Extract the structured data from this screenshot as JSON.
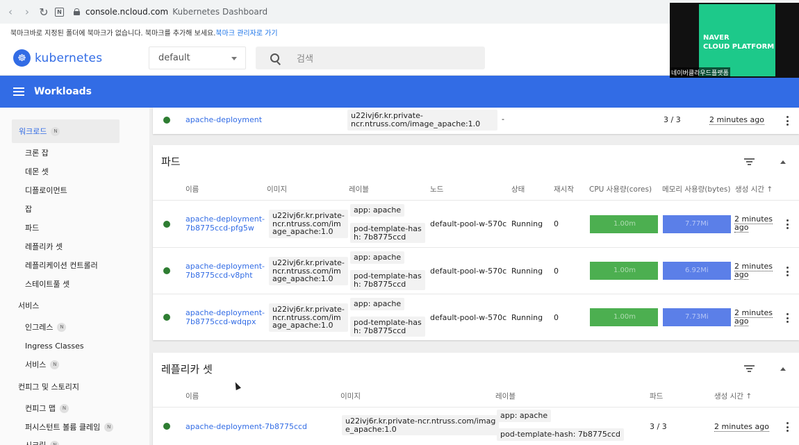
{
  "browser": {
    "url_host": "console.ncloud.com",
    "page_title": "Kubernetes Dashboard",
    "bookmark_msg": "북마크바로 지정된 폴더에 북마크가 없습니다. 북마크를 추가해 보세요.",
    "bookmark_link": "북마크 관리자로 가기"
  },
  "header": {
    "logo": "kubernetes",
    "namespace": "default",
    "search_placeholder": "검색"
  },
  "toolbar": {
    "title": "Workloads"
  },
  "sidebar": {
    "active": "워크로드",
    "active_badge": "N",
    "items_workload": [
      "크론 잡",
      "데몬 셋",
      "디플로이먼트",
      "잡",
      "파드",
      "레플리카 셋",
      "레플리케이션 컨트롤러",
      "스테이트풀 셋"
    ],
    "group_services": "서비스",
    "services": {
      "ingress": "인그레스",
      "ingress_classes": "Ingress Classes",
      "service": "서비스",
      "badge": "N"
    },
    "group_config": "컨피그 및 스토리지",
    "config": {
      "configmap": "컨피그 맵",
      "pvc": "퍼시스턴트 볼륨 클레임",
      "secret": "시크릿",
      "badge": "N"
    }
  },
  "deployment": {
    "name": "apache-deployment",
    "image": "u22ivj6r.kr.private-ncr.ntruss.com/image_apache:1.0",
    "labels": "-",
    "pods": "3 / 3",
    "created": "2 minutes ago"
  },
  "pods": {
    "title": "파드",
    "headers": {
      "name": "이름",
      "image": "이미지",
      "labels": "레이블",
      "node": "노드",
      "status": "상태",
      "restarts": "재시작",
      "cpu": "CPU 사용량(cores)",
      "memory": "메모리 사용량(bytes)",
      "created": "생성 시간"
    },
    "rows": [
      {
        "name1": "apache-deployment-",
        "name2": "7b8775ccd-pfg5w",
        "img1": "u22ivj6r.kr.private-",
        "img2": "ncr.ntruss.com/im",
        "img3": "age_apache:1.0",
        "label_app": "app: apache",
        "label_tpl1": "pod-template-has",
        "label_tpl2": "h: 7b8775ccd",
        "node": "default-pool-w-570c",
        "status": "Running",
        "restarts": "0",
        "cpu": "1.00m",
        "memory": "7.77Mi",
        "created1": "2 minutes",
        "created2": "ago"
      },
      {
        "name1": "apache-deployment-",
        "name2": "7b8775ccd-v8pht",
        "img1": "u22ivj6r.kr.private-",
        "img2": "ncr.ntruss.com/im",
        "img3": "age_apache:1.0",
        "label_app": "app: apache",
        "label_tpl1": "pod-template-has",
        "label_tpl2": "h: 7b8775ccd",
        "node": "default-pool-w-570c",
        "status": "Running",
        "restarts": "0",
        "cpu": "1.00m",
        "memory": "6.92Mi",
        "created1": "2 minutes",
        "created2": "ago"
      },
      {
        "name1": "apache-deployment-",
        "name2": "7b8775ccd-wdqpx",
        "img1": "u22ivj6r.kr.private-",
        "img2": "ncr.ntruss.com/im",
        "img3": "age_apache:1.0",
        "label_app": "app: apache",
        "label_tpl1": "pod-template-has",
        "label_tpl2": "h: 7b8775ccd",
        "node": "default-pool-w-570c",
        "status": "Running",
        "restarts": "0",
        "cpu": "1.00m",
        "memory": "7.73Mi",
        "created1": "2 minutes",
        "created2": "ago"
      }
    ]
  },
  "replicasets": {
    "title": "레플리카 셋",
    "headers": {
      "name": "이름",
      "image": "이미지",
      "labels": "레이블",
      "pods": "파드",
      "created": "생성 시간"
    },
    "row": {
      "name": "apache-deployment-7b8775ccd",
      "img1": "u22ivj6r.kr.private-ncr.ntruss.com/imag",
      "img2": "e_apache:1.0",
      "label_app": "app: apache",
      "label_tpl": "pod-template-hash: 7b8775ccd",
      "pods": "3 / 3",
      "created": "2 minutes ago"
    }
  },
  "overlay": {
    "brand1": "NAVER",
    "brand2": "CLOUD PLATFORM",
    "caption": "네이버클라우드플랫폼"
  },
  "colors": {
    "accent": "#326ce5",
    "status_ok": "#2e7d32",
    "cpu": "#4caf50",
    "memory": "#5b7fe8"
  }
}
